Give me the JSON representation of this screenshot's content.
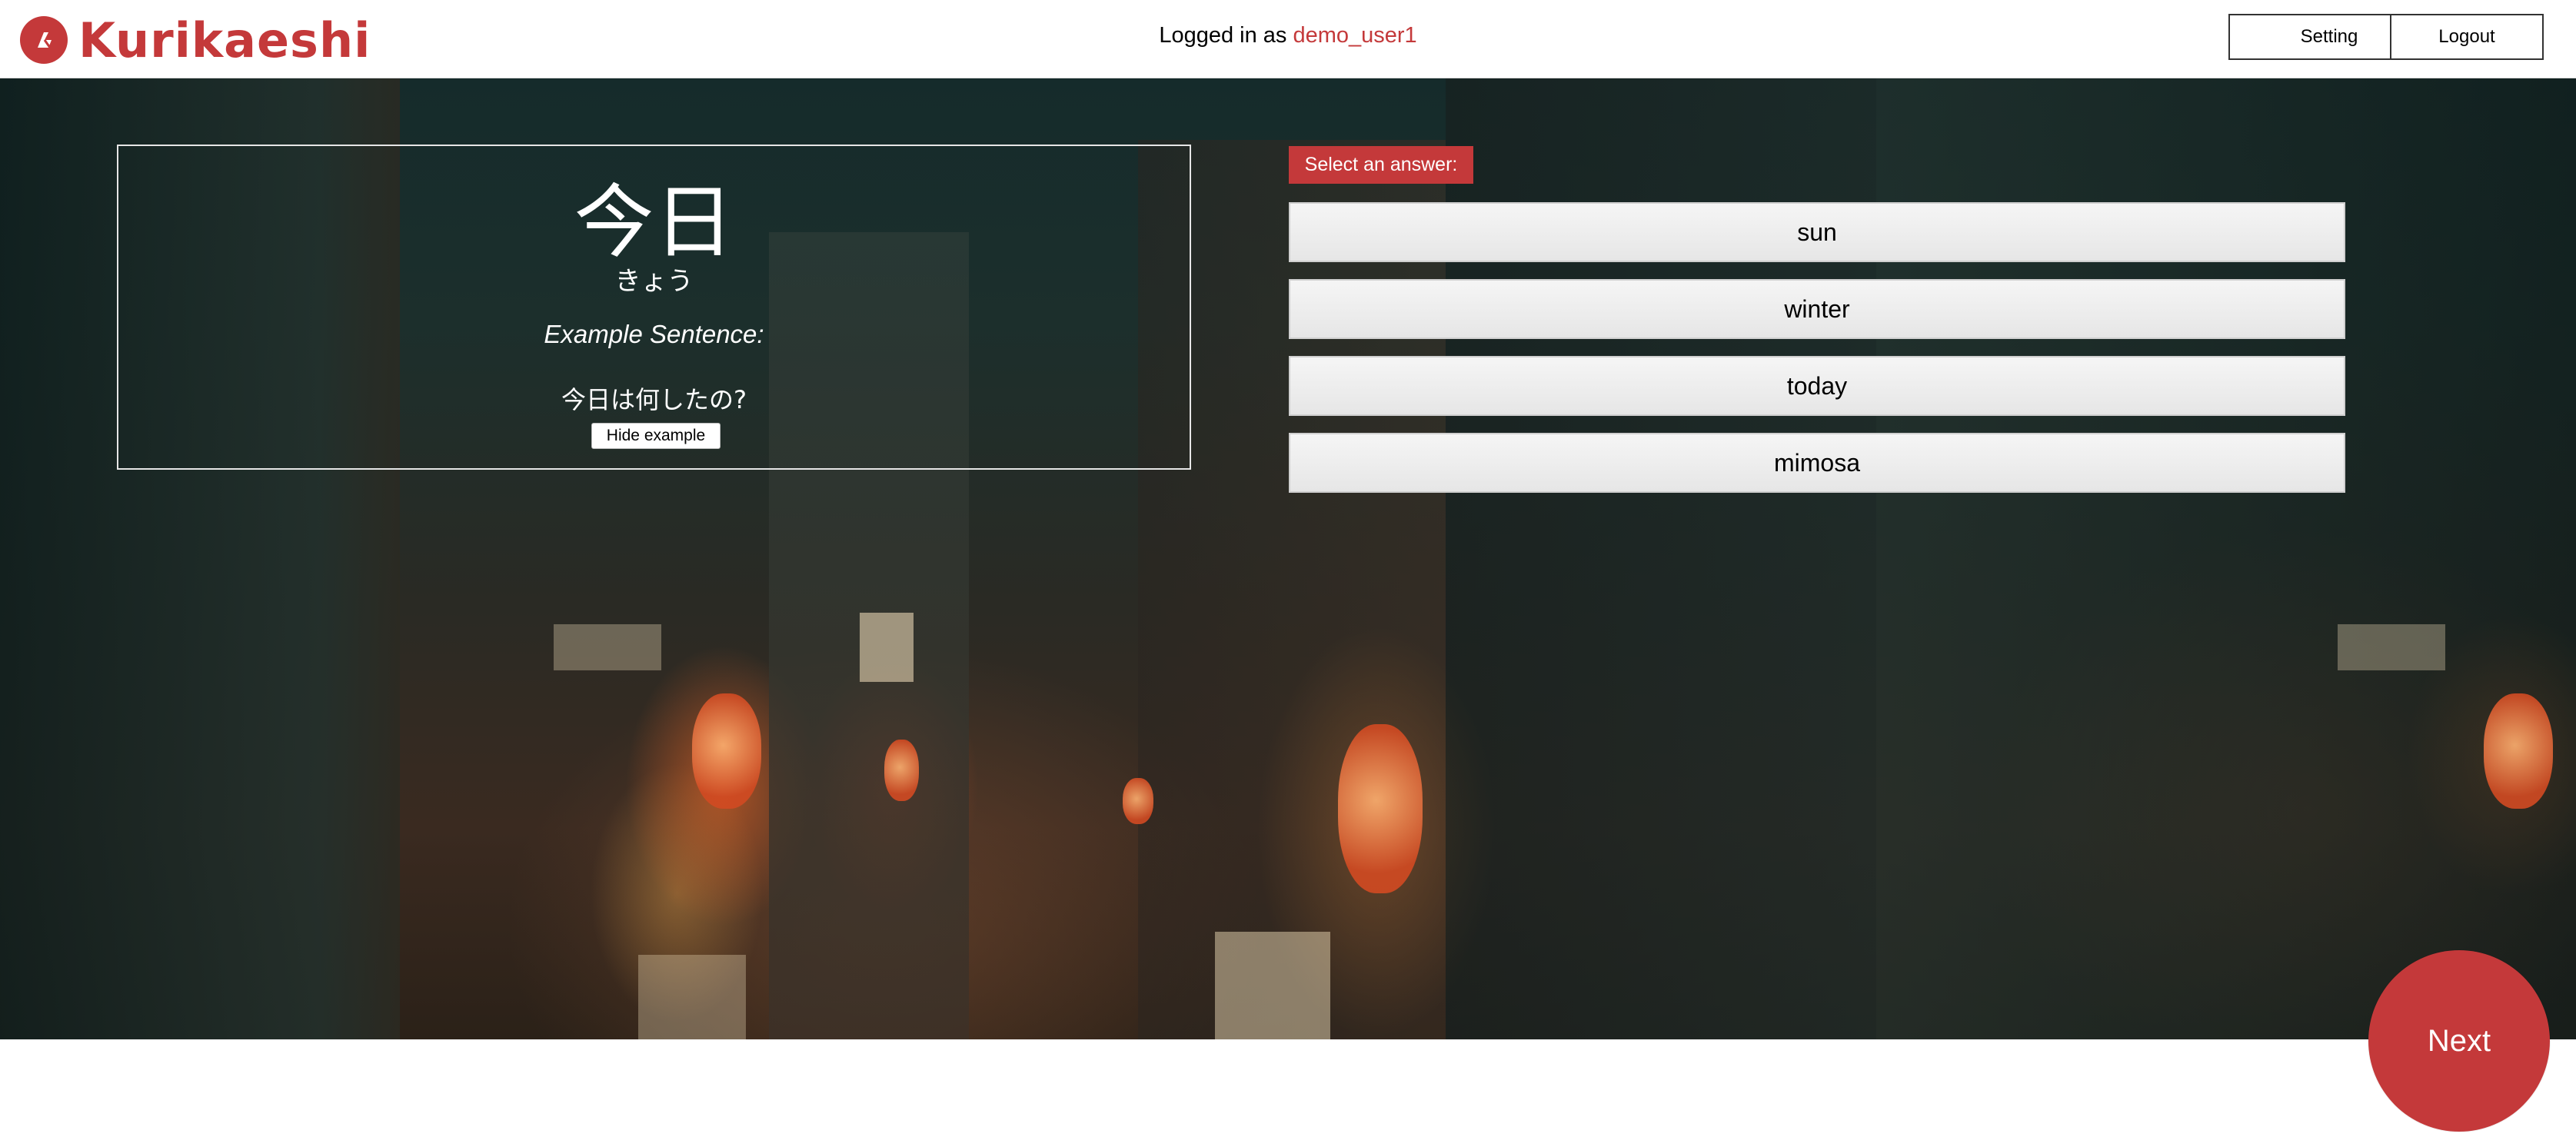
{
  "header": {
    "logo_text": "Kurikaeshi",
    "logged_in_prefix": "Logged in as ",
    "username": "demo_user1",
    "setting_label": "Setting",
    "logout_label": "Logout"
  },
  "card": {
    "kanji": "今日",
    "reading": "きょう",
    "example_label": "Example Sentence:",
    "example_sentence": "今日は何したの?",
    "hide_button": "Hide example"
  },
  "quiz": {
    "prompt": "Select an answer:",
    "answers": [
      "sun",
      "winter",
      "today",
      "mimosa"
    ]
  },
  "next_label": "Next",
  "colors": {
    "brand": "#c4393a",
    "answer_bg": "#efefef"
  },
  "icons": {
    "logo": "kurikaeshi-logo-icon"
  }
}
